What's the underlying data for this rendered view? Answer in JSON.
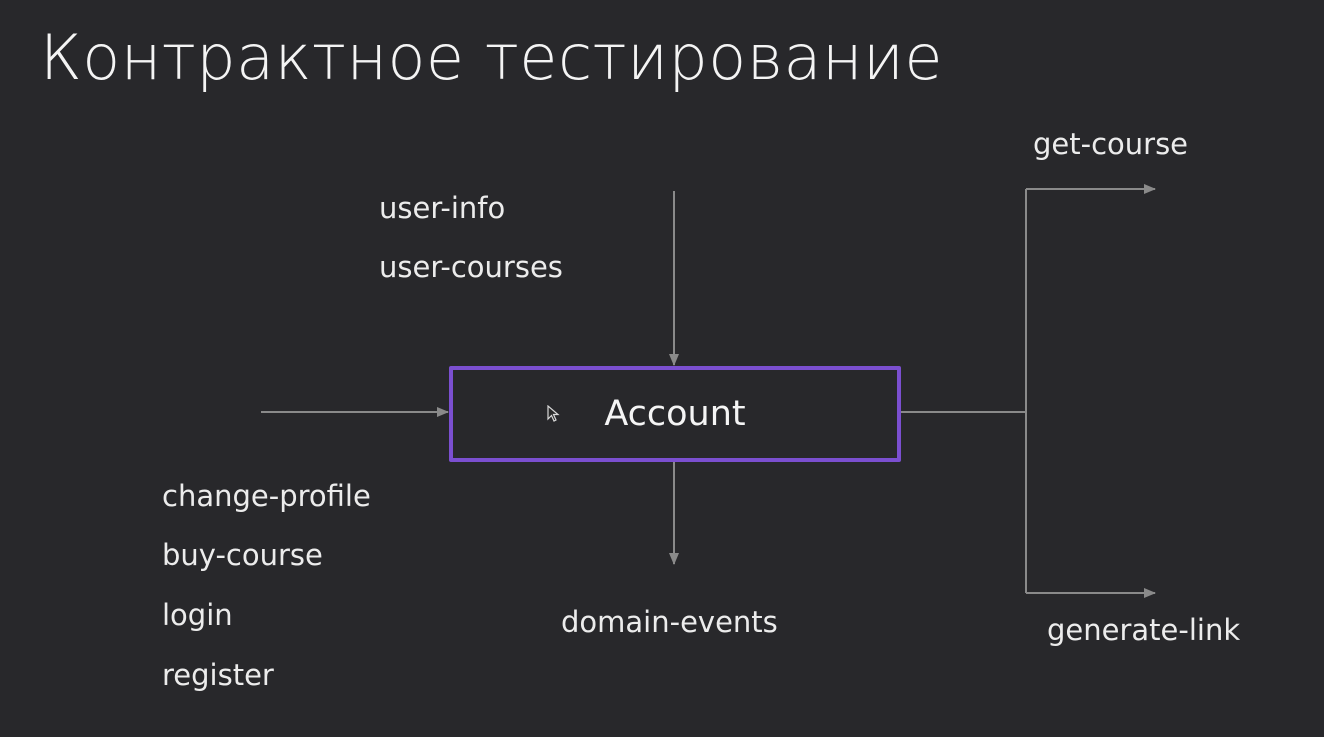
{
  "slide": {
    "title": "Контрактное тестирование"
  },
  "diagram": {
    "center_node": "Account",
    "top_inputs": [
      "user-info",
      "user-courses"
    ],
    "left_inputs": [
      "change-profile",
      "buy-course",
      "login",
      "register"
    ],
    "bottom_output": "domain-events",
    "right_outputs": [
      "get-course",
      "generate-link"
    ]
  },
  "colors": {
    "background": "#28282b",
    "box_border": "#7b4fd0",
    "arrows": "#8a8a8a",
    "text": "#f2f2f2"
  }
}
